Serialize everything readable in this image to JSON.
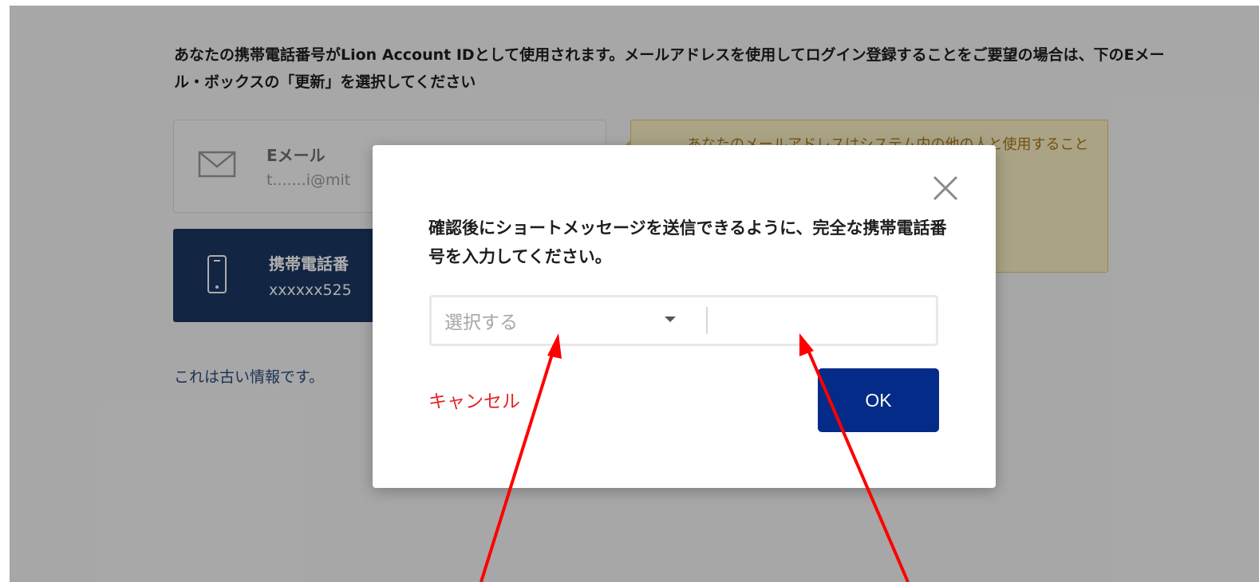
{
  "page": {
    "intro_text": "あなたの携帯電話番号がLion Account IDとして使用されます。メールアドレスを使用してログイン登録することをご要望の場合は、下のEメール・ボックスの「更新」を選択してください",
    "email_card": {
      "title": "Eメール",
      "value": "t.......i@mit"
    },
    "phone_card": {
      "title": "携帯電話番",
      "value": "xxxxxx525"
    },
    "old_info_link": "これは古い情報です。",
    "warning_text": "あなたのメールアドレスはシステム内の他の人と使用すること"
  },
  "modal": {
    "message": "確認後にショートメッセージを送信できるように、完全な携帯電話番号を入力してください。",
    "country_select": {
      "placeholder": "選択する"
    },
    "number_field": {
      "value": ""
    },
    "cancel_label": "キャンセル",
    "ok_label": "OK"
  },
  "icons": {
    "close": "close-icon",
    "mail": "mail-icon",
    "phone": "phone-icon",
    "dropdown": "caret-down-icon"
  },
  "colors": {
    "primary": "#032b87",
    "phone_card_bg": "#1b3963",
    "cancel": "#e5252a",
    "annotation_arrow": "#ff0000",
    "overlay": "rgba(0,0,0,0.32)"
  }
}
